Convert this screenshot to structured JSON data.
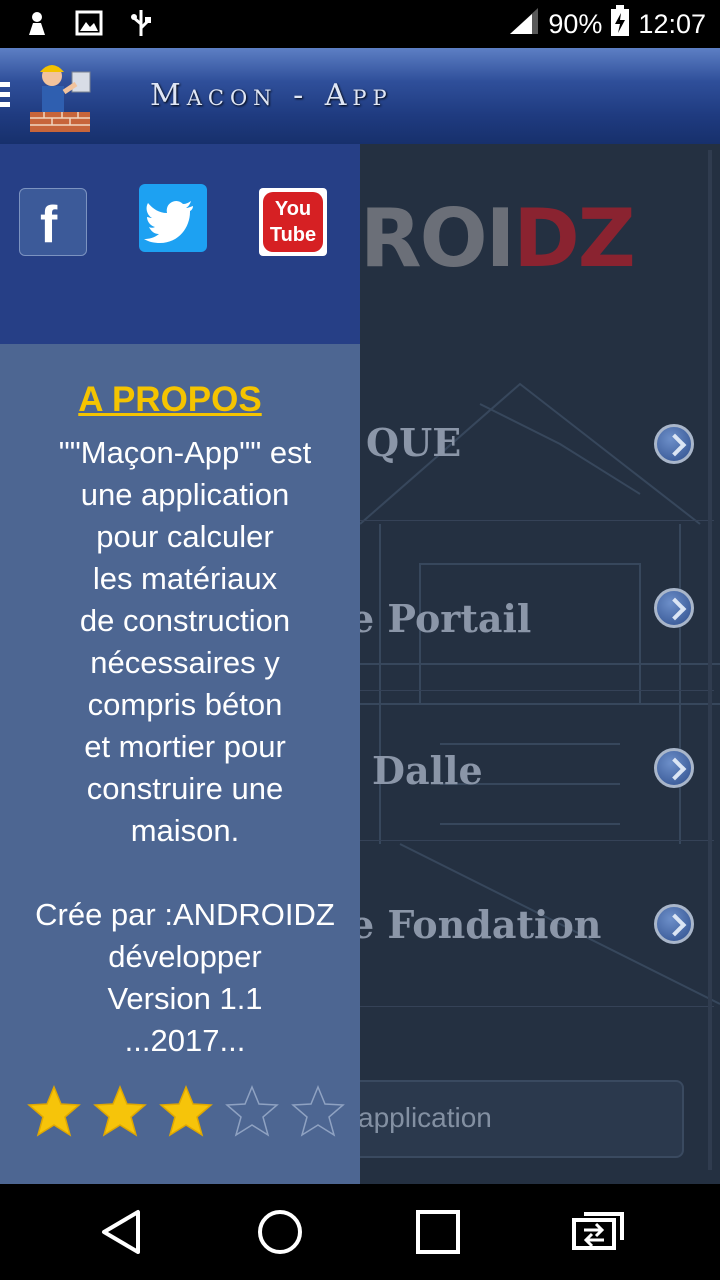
{
  "status_bar": {
    "battery": "90%",
    "time": "12:07",
    "icons": [
      "android-debug-icon",
      "image-icon",
      "usb-icon",
      "signal-icon",
      "battery-charging-icon"
    ]
  },
  "app_bar": {
    "title": "Macon - App",
    "menu_icon": "hamburger-icon",
    "logo": "mason-worker-logo"
  },
  "background": {
    "brand_part1": "ROI",
    "brand_part2": "DZ",
    "menu_items": [
      {
        "label": "QUE"
      },
      {
        "label": "e Portail"
      },
      {
        "label": "Dalle"
      },
      {
        "label": "e Fondation"
      }
    ],
    "button_label": "application"
  },
  "drawer": {
    "social": [
      "facebook-icon",
      "twitter-icon",
      "youtube-icon"
    ],
    "facebook_glyph": "f",
    "youtube_line1": "You",
    "youtube_line2": "Tube",
    "about_title": "A PROPOS",
    "about_lines": [
      "\"\"Maçon-App\"\"  est",
      "une application",
      "pour calculer",
      "les matériaux",
      "de construction",
      "nécessaires y",
      "compris béton",
      "et mortier pour",
      "construire une",
      "maison.",
      "",
      "Crée par :ANDROIDZ",
      "développer",
      "Version 1.1",
      "...2017..."
    ],
    "rating": 3,
    "rating_max": 5,
    "colors": {
      "title": "#f5c400",
      "drawer": "#4d6692",
      "drawer_head": "#263f86"
    }
  },
  "nav_bar": {
    "buttons": [
      "back-icon",
      "home-icon",
      "recents-icon",
      "switch-app-icon"
    ]
  }
}
